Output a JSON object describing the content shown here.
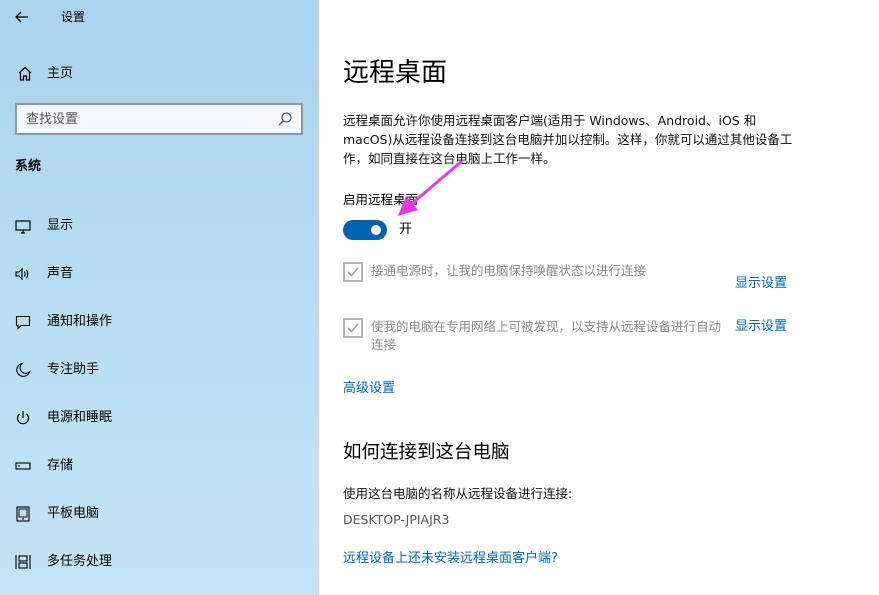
{
  "window": {
    "title": "设置"
  },
  "sidebar": {
    "home_label": "主页",
    "search_placeholder": "查找设置",
    "section": "系统",
    "items": [
      {
        "label": "显示",
        "icon": "monitor-icon"
      },
      {
        "label": "声音",
        "icon": "speaker-icon"
      },
      {
        "label": "通知和操作",
        "icon": "message-icon"
      },
      {
        "label": "专注助手",
        "icon": "moon-icon"
      },
      {
        "label": "电源和睡眠",
        "icon": "power-icon"
      },
      {
        "label": "存储",
        "icon": "storage-icon"
      },
      {
        "label": "平板电脑",
        "icon": "tablet-icon"
      },
      {
        "label": "多任务处理",
        "icon": "multitask-icon"
      }
    ]
  },
  "main": {
    "title": "远程桌面",
    "description": "远程桌面允许你使用远程桌面客户端(适用于 Windows、Android、iOS 和 macOS)从远程设备连接到这台电脑并加以控制。这样，你就可以通过其他设备工作，如同直接在这台电脑上工作一样。",
    "enable_label": "启用远程桌面",
    "toggle_state": "开",
    "checkbox1": {
      "label": "接通电源时，让我的电脑保持唤醒状态以进行连接",
      "checked": true,
      "link": "显示设置"
    },
    "checkbox2": {
      "label": "使我的电脑在专用网络上可被发现，以支持从远程设备进行自动连接",
      "checked": true,
      "link": "显示设置"
    },
    "advanced_link": "高级设置",
    "section2_title": "如何连接到这台电脑",
    "section2_text": "使用这台电脑的名称从远程设备进行连接:",
    "pc_name": "DESKTOP-JPIAJR3",
    "client_link": "远程设备上还未安装远程桌面客户端?"
  },
  "colors": {
    "accent": "#0063b1",
    "link": "#0067c0",
    "annotation_arrow": "#e23be2"
  }
}
